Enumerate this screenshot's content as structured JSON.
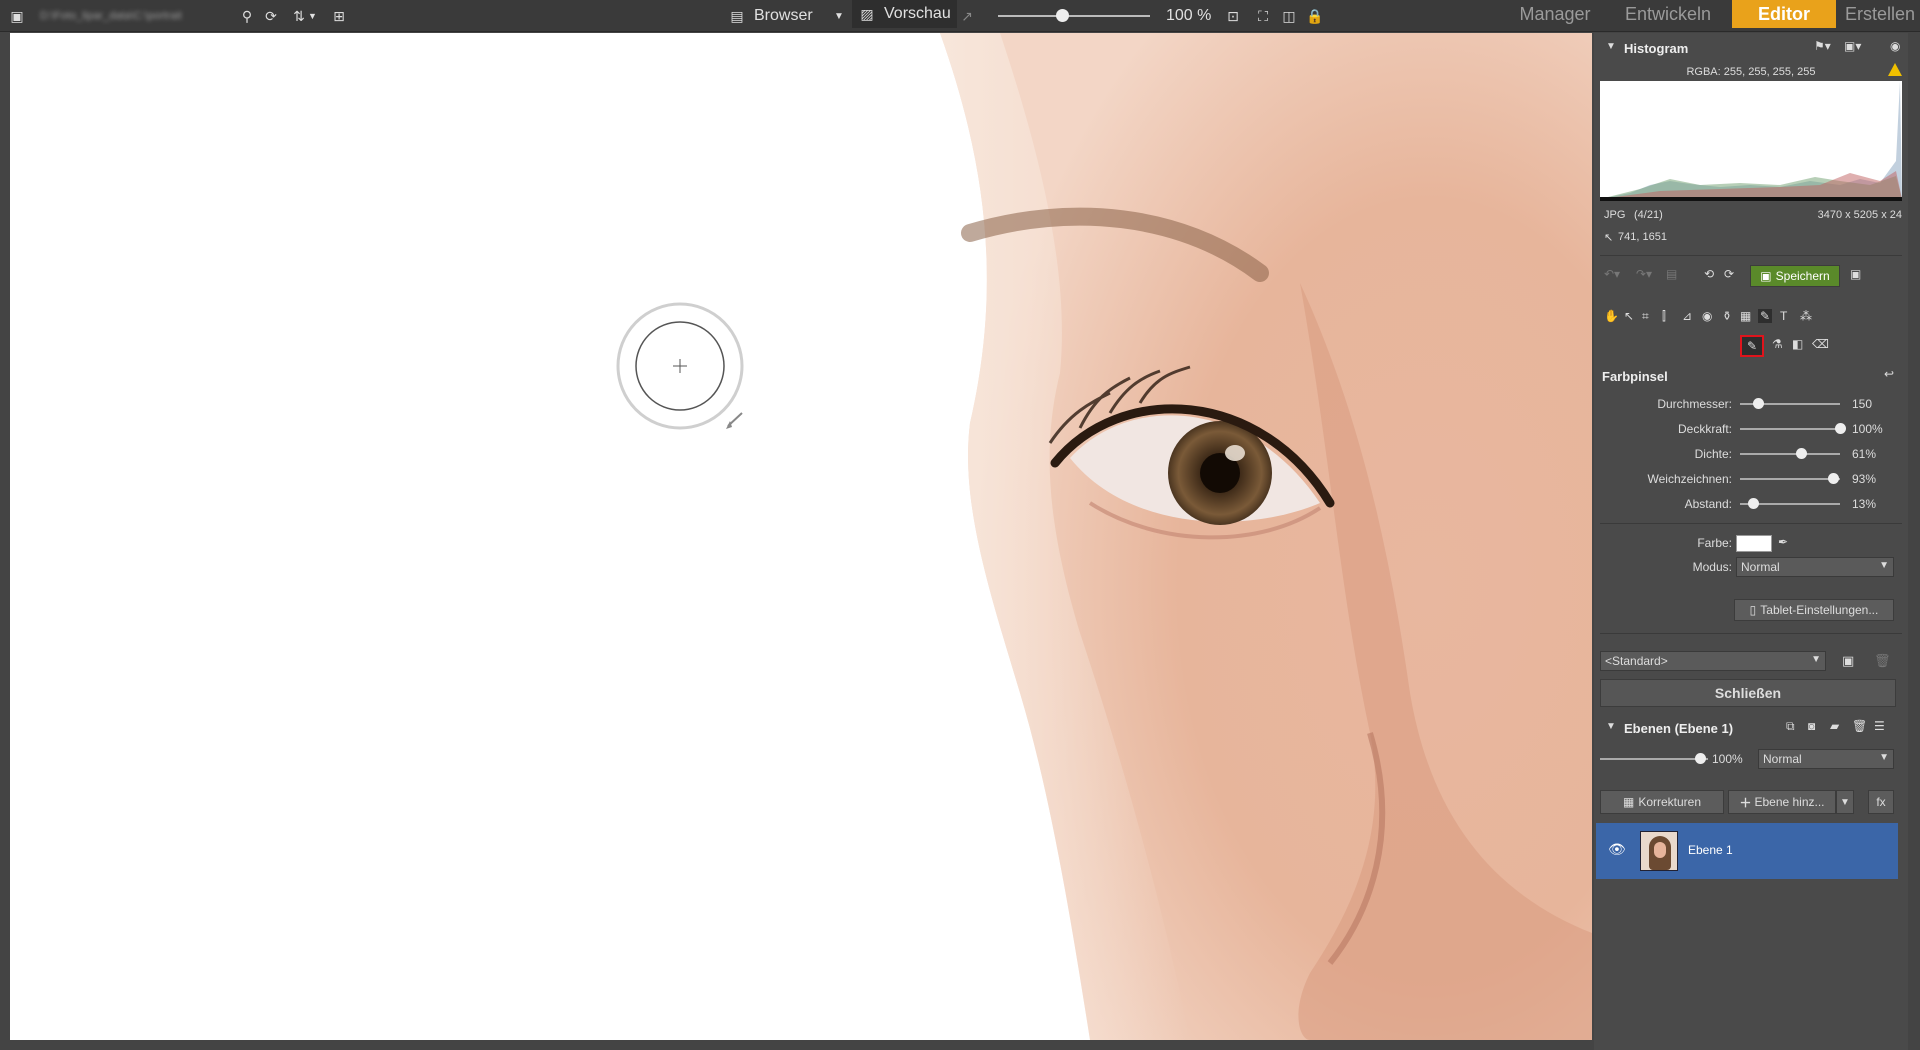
{
  "topbar": {
    "path_text": "D:\\Foto_lipar_data\\C:\\portrait",
    "browser_label": "Browser",
    "preview_label": "Vorschau",
    "zoom_label": "100 %",
    "zoom_level": 0.42,
    "tabs": [
      {
        "label": "Manager",
        "active": false
      },
      {
        "label": "Entwickeln",
        "active": false
      },
      {
        "label": "Editor",
        "active": true
      },
      {
        "label": "Erstellen",
        "active": false
      }
    ]
  },
  "histogram": {
    "title": "Histogram",
    "rgba": "RGBA: 255, 255, 255, 255",
    "format": "JPG",
    "index": "(4/21)",
    "dimensions": "3470 x 5205 x 24",
    "coords": "741, 1651",
    "warning_color": "#f0c000"
  },
  "toolbar": {
    "save_label": "Speichern",
    "save_color": "#5a8a2a"
  },
  "brush": {
    "title": "Farbpinsel",
    "sliders": [
      {
        "label": "Durchmesser:",
        "value": "150",
        "pos": 0.18
      },
      {
        "label": "Deckkraft:",
        "value": "100%",
        "pos": 1.0
      },
      {
        "label": "Dichte:",
        "value": "61%",
        "pos": 0.61
      },
      {
        "label": "Weichzeichnen:",
        "value": "93%",
        "pos": 0.93
      },
      {
        "label": "Abstand:",
        "value": "13%",
        "pos": 0.13
      }
    ],
    "color_label": "Farbe:",
    "color_value": "#ffffff",
    "mode_label": "Modus:",
    "mode_value": "Normal",
    "tablet_label": "Tablet-Einstellungen..."
  },
  "preset": {
    "value": "<Standard>",
    "close_label": "Schließen"
  },
  "layers": {
    "title": "Ebenen (Ebene 1)",
    "opacity": "100%",
    "opacity_pos": 1.0,
    "blend": "Normal",
    "corrections_label": "Korrekturen",
    "add_layer_label": "Ebene hinz...",
    "fx_label": "fx",
    "items": [
      {
        "name": "Ebene 1",
        "selected": true,
        "color": "#3b66a8"
      }
    ]
  }
}
